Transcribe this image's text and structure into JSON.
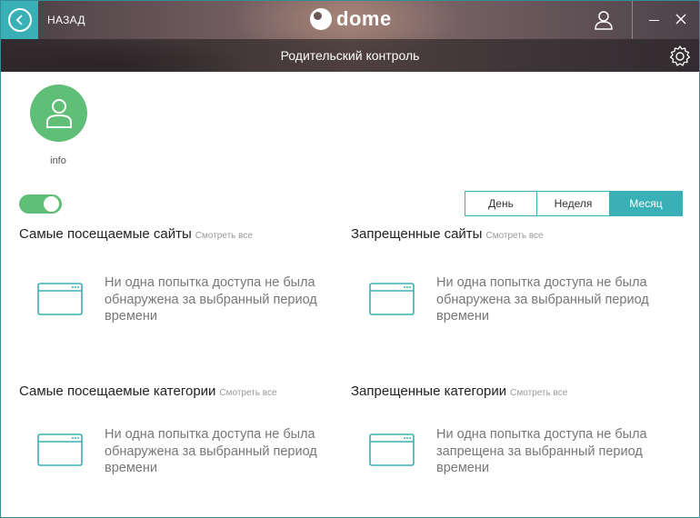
{
  "header": {
    "back_label": "НАЗАД",
    "logo_text": "dome",
    "title": "Родительский контроль"
  },
  "profile": {
    "name": "info"
  },
  "toggle": {
    "on": true
  },
  "period": {
    "options": [
      "День",
      "Неделя",
      "Месяц"
    ],
    "selected": "Месяц"
  },
  "sections": [
    {
      "title": "Самые посещаемые сайты",
      "see_all": "Смотреть все",
      "empty": "Ни одна попытка доступа не была обнаружена за выбранный период времени"
    },
    {
      "title": "Запрещенные сайты",
      "see_all": "Смотреть все",
      "empty": "Ни одна попытка доступа не была обнаружена за выбранный период времени"
    },
    {
      "title": "Самые посещаемые категории",
      "see_all": "Смотреть все",
      "empty": "Ни одна попытка доступа не была обнаружена за выбранный период времени"
    },
    {
      "title": "Запрещенные категории",
      "see_all": "Смотреть все",
      "empty": "Ни одна попытка доступа не была запрещена за выбранный период времени"
    }
  ],
  "colors": {
    "accent": "#39b0b5",
    "avatar": "#5fbf77",
    "toggle_on": "#5fbf77"
  },
  "icons": {
    "back": "chevron-left-icon",
    "user": "user-icon",
    "minimize": "minimize-icon",
    "close": "close-icon",
    "settings": "gear-icon",
    "empty_state": "browser-window-icon"
  }
}
